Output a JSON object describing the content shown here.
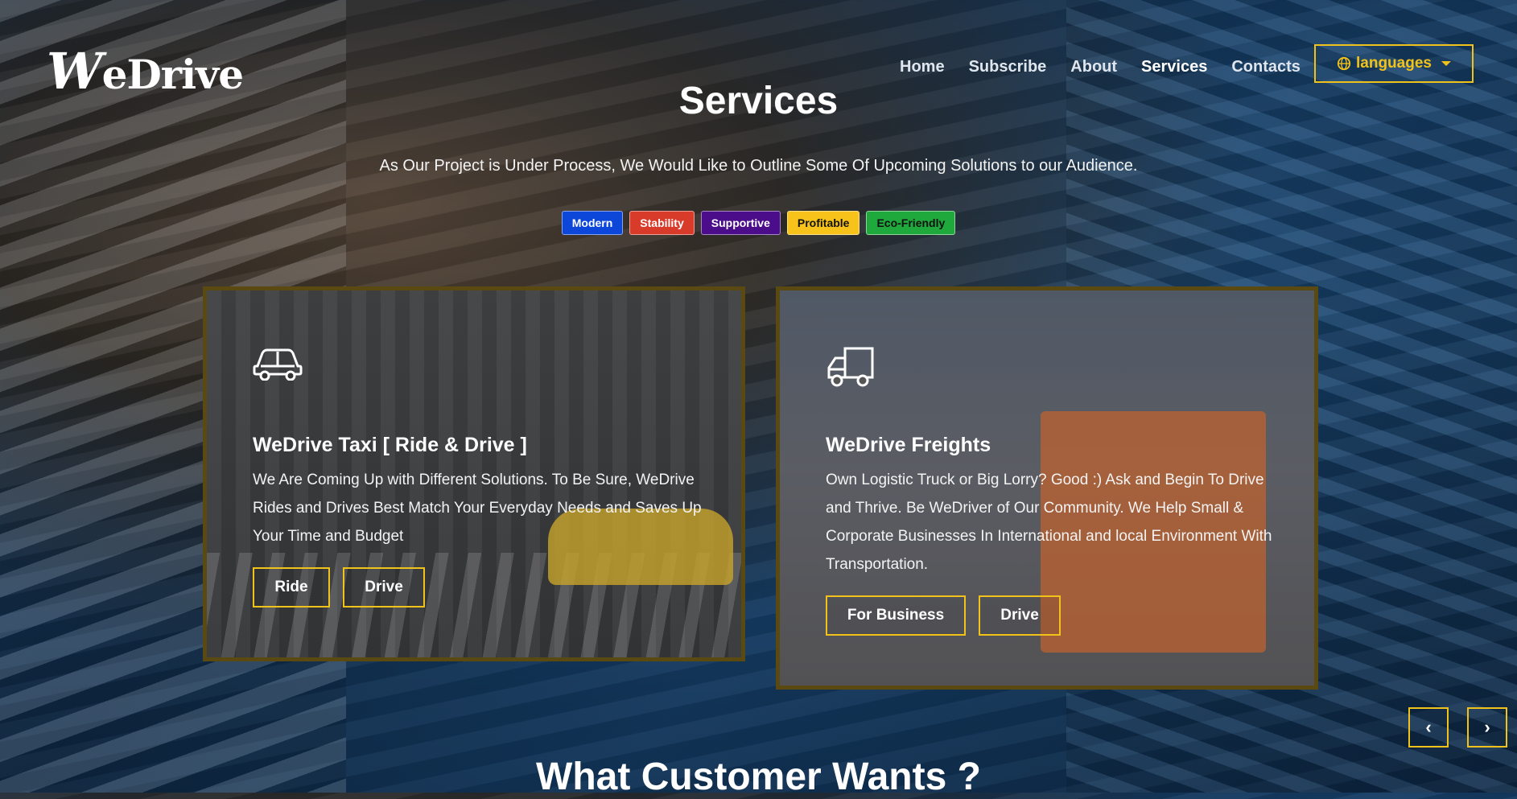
{
  "brand": {
    "logo_initial": "W",
    "logo_rest": "eDrive"
  },
  "nav": [
    {
      "label": "Home"
    },
    {
      "label": "Subscribe"
    },
    {
      "label": "About"
    },
    {
      "label": "Services"
    },
    {
      "label": "Contacts"
    }
  ],
  "nav_active": "Services",
  "language_button": {
    "label": "languages",
    "icon": "globe-icon"
  },
  "services": {
    "title": "Services",
    "intro": "As Our Project is Under Process, We Would Like to Outline Some Of Upcoming Solutions to our Audience.",
    "badges": [
      {
        "label": "Modern",
        "color": "#0d47d9",
        "text_color": "#ffffff"
      },
      {
        "label": "Stability",
        "color": "#d93b2b",
        "text_color": "#ffffff"
      },
      {
        "label": "Supportive",
        "color": "#4b0d8a",
        "text_color": "#ffffff"
      },
      {
        "label": "Profitable",
        "color": "#f7c21a",
        "text_color": "#111111"
      },
      {
        "label": "Eco-Friendly",
        "color": "#1fa83b",
        "text_color": "#111111"
      }
    ]
  },
  "cards": [
    {
      "icon": "car-icon",
      "title": "WeDrive Taxi [ Ride & Drive ]",
      "text": "We Are Coming Up with Different Solutions. To Be Sure, WeDrive Rides and Drives Best Match Your Everyday Needs and Saves Up Your Time and Budget",
      "buttons": [
        "Ride",
        "Drive"
      ]
    },
    {
      "icon": "truck-icon",
      "title": "WeDrive Freights",
      "text": "Own Logistic Truck or Big Lorry? Good :) Ask and Begin To Drive and Thrive. Be WeDriver of Our Community. We Help Small & Corporate Businesses In International and local Environment With Transportation.",
      "buttons": [
        "For Business",
        "Drive"
      ]
    }
  ],
  "carousel": {
    "prev": "‹",
    "next": "›"
  },
  "next_section_title": "What Customer Wants ?",
  "colors": {
    "accent": "#f1c21a"
  }
}
